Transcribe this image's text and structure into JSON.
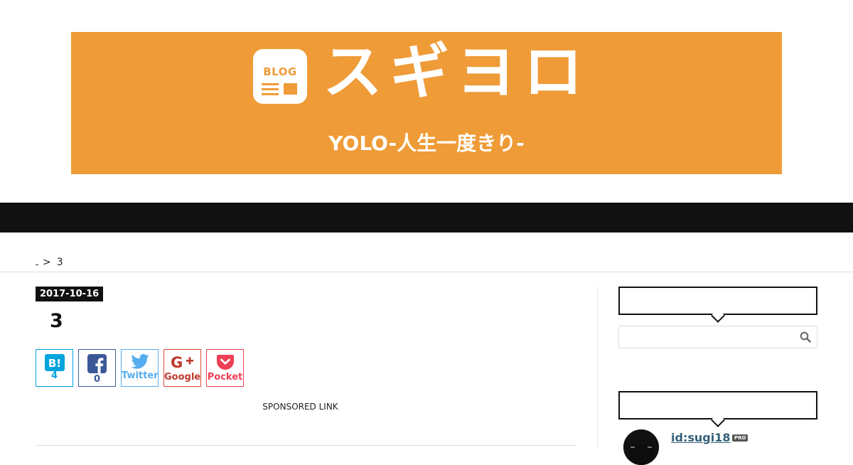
{
  "header": {
    "logo_text": "BLOG",
    "title": "スギヨロ",
    "subtitle": "YOLO-人生一度きり-",
    "brand_color": "#ef9b37"
  },
  "breadcrumb": {
    "separator": ">",
    "current": "3"
  },
  "entry": {
    "date": "2017-10-16",
    "title": "3"
  },
  "share_buttons": [
    {
      "service": "hatena",
      "icon": "hatena-bookmark-icon",
      "label": "B!",
      "count": "4",
      "color": "#00a4de"
    },
    {
      "service": "facebook",
      "icon": "facebook-icon",
      "label": "",
      "count": "0",
      "color": "#3b5998"
    },
    {
      "service": "twitter",
      "icon": "twitter-bird-icon",
      "label": "Twitter",
      "color": "#55acee"
    },
    {
      "service": "google",
      "icon": "google-plus-icon",
      "label": "Google",
      "color": "#dd4b39"
    },
    {
      "service": "pocket",
      "icon": "pocket-icon",
      "label": "Pocket",
      "color": "#ef4056"
    }
  ],
  "sponsored_label": "SPONSORED LINK",
  "sidebar": {
    "search": {
      "placeholder": "",
      "icon": "search-icon"
    },
    "profile": {
      "user_id": "id:sugi18",
      "badge": "PRO"
    }
  }
}
